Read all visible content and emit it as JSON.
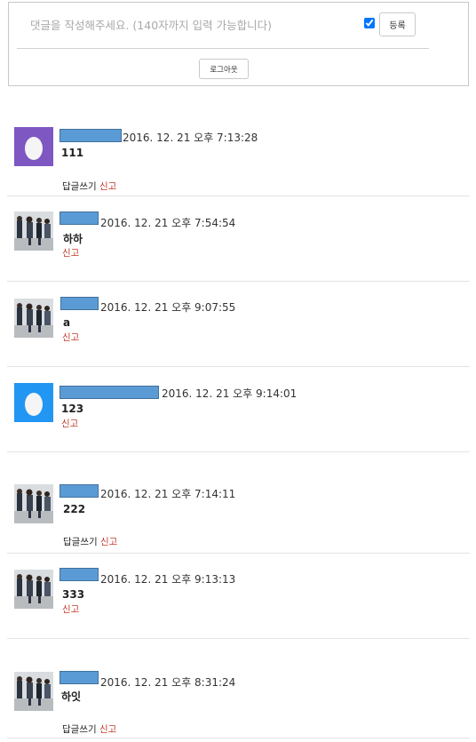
{
  "compose": {
    "placeholder": "댓글을 작성해주세요. (140자까지 입력 가능합니다)",
    "secret_checked": true,
    "submit_label": "등록",
    "logout_label": "로그아웃"
  },
  "labels": {
    "reply": "답글쓰기",
    "report": "신고"
  },
  "comments": [
    {
      "timestamp": "2016. 12. 21 오후 7:13:28",
      "text": "111",
      "avatar": "purple-egg",
      "show_reply": true
    },
    {
      "timestamp": "2016. 12. 21 오후 7:54:54",
      "text": "하하",
      "avatar": "photo",
      "show_reply": false
    },
    {
      "timestamp": "2016. 12. 21 오후 9:07:55",
      "text": "a",
      "avatar": "photo",
      "show_reply": false
    },
    {
      "timestamp": "2016. 12. 21 오후 9:14:01",
      "text": "123",
      "avatar": "blue-egg",
      "show_reply": false
    },
    {
      "timestamp": "2016. 12. 21 오후 7:14:11",
      "text": "222",
      "avatar": "photo",
      "show_reply": true
    },
    {
      "timestamp": "2016. 12. 21 오후 9:13:13",
      "text": "333",
      "avatar": "photo",
      "show_reply": false
    },
    {
      "timestamp": "2016. 12. 21 오후 8:31:24",
      "text": "하잇",
      "avatar": "photo",
      "show_reply": true
    }
  ],
  "colors": {
    "egg_purple": "#7e57c2",
    "egg_blue": "#2196f3",
    "name_redaction": "#5b9bd5",
    "report_red": "#c0392b"
  }
}
